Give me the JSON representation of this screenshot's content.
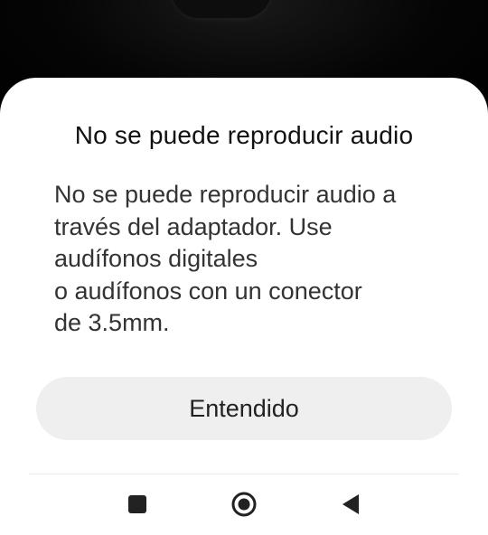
{
  "dialog": {
    "title": "No se puede reproducir audio",
    "message_lines": [
      "No se puede reproducir audio a",
      "través del adaptador. Use",
      "audífonos digitales",
      "o audífonos con un conector",
      "de 3.5mm."
    ],
    "confirm_label": "Entendido"
  },
  "navbar": {
    "icons": [
      "recents-square-icon",
      "home-circle-icon",
      "back-triangle-icon"
    ]
  },
  "colors": {
    "sheet_background": "#ffffff",
    "button_background": "#efefef",
    "title_text": "#111111",
    "body_text": "#333333",
    "nav_icon": "#222222"
  }
}
